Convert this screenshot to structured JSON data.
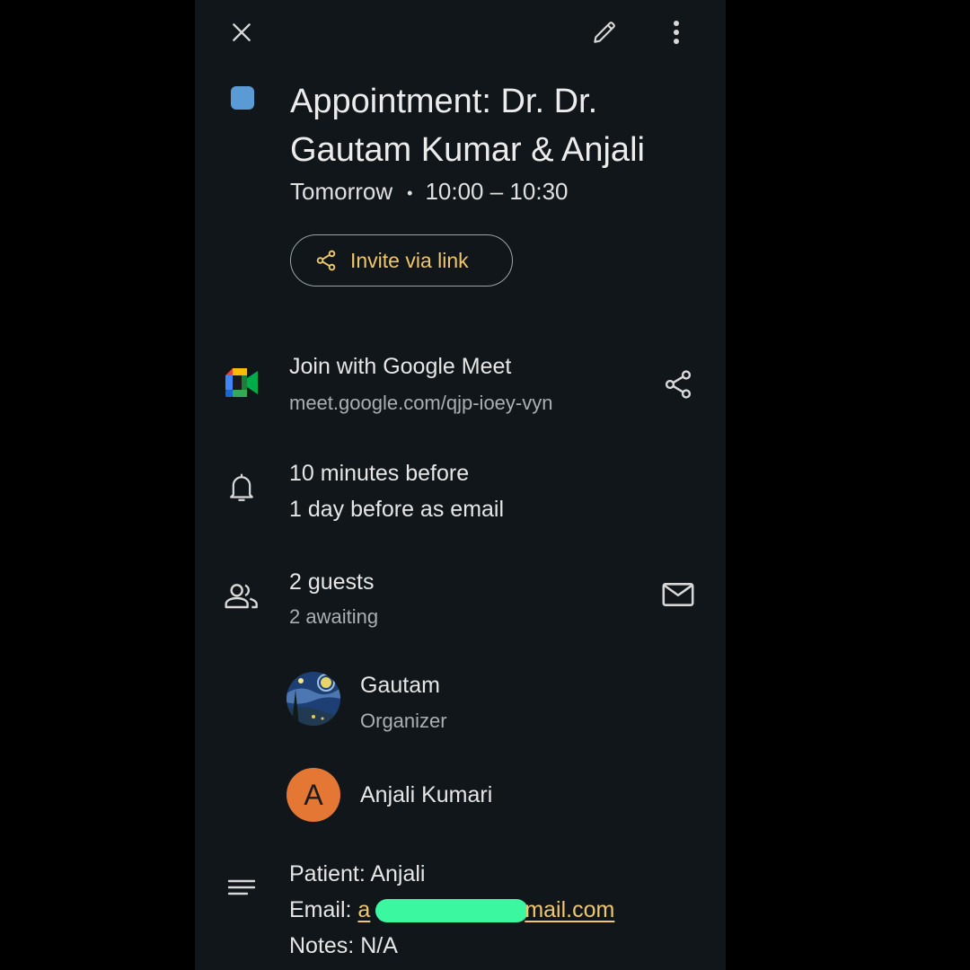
{
  "header": {
    "close_icon": "close-icon",
    "edit_icon": "pencil-icon",
    "more_icon": "more-vert-icon"
  },
  "event": {
    "color": "#5b9bd5",
    "title": "Appointment: Dr. Dr. Gautam Kumar & Anjali",
    "day": "Tomorrow",
    "separator": "•",
    "time": "10:00 – 10:30",
    "invite_label": "Invite via link"
  },
  "meet": {
    "label": "Join with Google Meet",
    "url": "meet.google.com/qjp-ioey-vyn"
  },
  "notifications": {
    "line1": "10 minutes before",
    "line2": "1 day before as email"
  },
  "guests": {
    "count": "2 guests",
    "status": "2 awaiting",
    "list": [
      {
        "name": "Gautam",
        "role": "Organizer"
      },
      {
        "name": "Anjali Kumari",
        "initial": "A"
      }
    ]
  },
  "description": {
    "patient": "Patient: Anjali",
    "email_label": "Email:",
    "email_start": "a",
    "email_end": "mail.com",
    "notes": "Notes: N/A"
  },
  "colors": {
    "accent": "#f0c76c",
    "background": "#101619",
    "avatar_orange": "#e57734",
    "redaction": "#3af7a0"
  }
}
